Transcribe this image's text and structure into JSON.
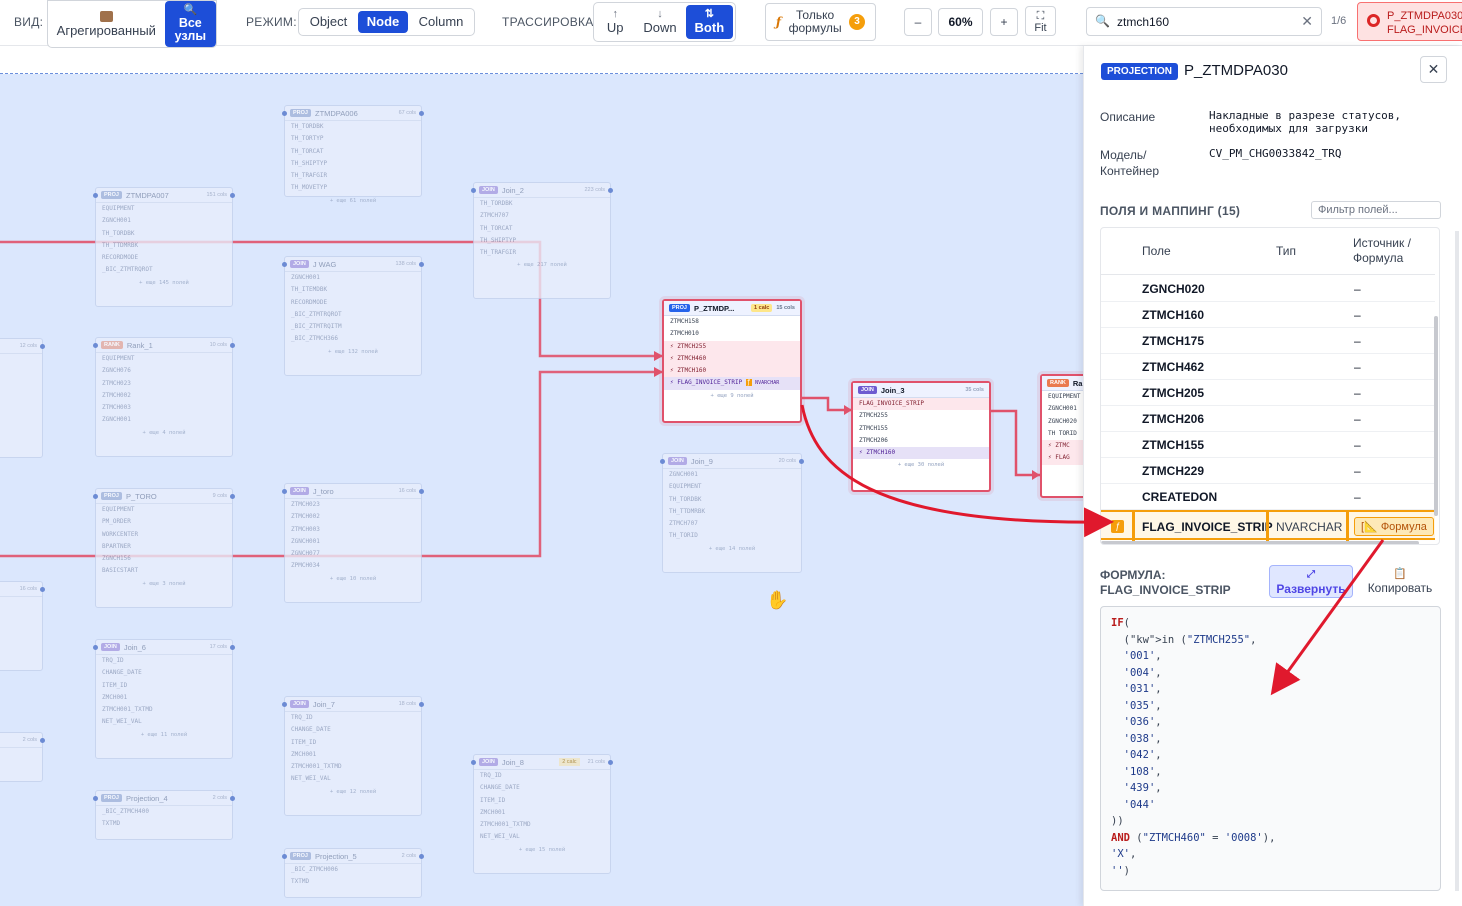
{
  "toolbar": {
    "view_label": "ВИД:",
    "view_options": [
      {
        "label": "Агрегированный",
        "active": false
      },
      {
        "label": "Все узлы",
        "active": true
      }
    ],
    "mode_label": "РЕЖИМ:",
    "mode_options": [
      "Object",
      "Node",
      "Column"
    ],
    "mode_active": "Node",
    "trace_label": "ТРАССИРОВКА:",
    "trace_options": [
      "Up",
      "Down",
      "Both"
    ],
    "trace_active": "Both",
    "formulas_only_label": "Только формулы",
    "formulas_count": "3",
    "zoom_out": "–",
    "zoom_level": "60%",
    "zoom_in": "+",
    "fit_label": "Fit",
    "search_value": "ztmch160",
    "search_count": "1/6",
    "context_chip": "P_ZTMDPA030 FLAG_INVOICE_"
  },
  "panel": {
    "badge": "PROJECTION",
    "title": "P_ZTMDPA030",
    "desc_label": "Описание",
    "desc_value": "Накладные в разрезе статусов, необходимых для загрузки",
    "model_label": "Модель/ Контейнер",
    "model_value": "CV_PM_CHG0033842_TRQ",
    "fields_heading": "ПОЛЯ И МАППИНГ (15)",
    "filter_placeholder": "Фильтр полей...",
    "col_field": "Поле",
    "col_type": "Тип",
    "col_source": "Источник / Формула",
    "rows": [
      {
        "field": "ZGNCH020",
        "type": "",
        "source": "–"
      },
      {
        "field": "ZTMCH160",
        "type": "",
        "source": "–"
      },
      {
        "field": "ZTMCH175",
        "type": "",
        "source": "–"
      },
      {
        "field": "ZTMCH462",
        "type": "",
        "source": "–"
      },
      {
        "field": "ZTMCH205",
        "type": "",
        "source": "–"
      },
      {
        "field": "ZTMCH206",
        "type": "",
        "source": "–"
      },
      {
        "field": "ZTMCH155",
        "type": "",
        "source": "–"
      },
      {
        "field": "ZTMCH229",
        "type": "",
        "source": "–"
      },
      {
        "field": "CREATEDON",
        "type": "",
        "source": "–"
      }
    ],
    "selected_row": {
      "field": "FLAG_INVOICE_STRIP",
      "type": "NVARCHAR",
      "source": "Формула"
    },
    "formula_heading": "ФОРМУЛА:",
    "formula_field": "FLAG_INVOICE_STRIP",
    "expand_label": "Развернуть",
    "copy_label": "Копировать",
    "formula_lines": [
      {
        "kw": "IF",
        "rest": "("
      },
      {
        "kw": "",
        "rest": "  (in (\"ZTMCH255\","
      },
      {
        "kw": "",
        "rest": "  '001',"
      },
      {
        "kw": "",
        "rest": "  '004',"
      },
      {
        "kw": "",
        "rest": "  '031',"
      },
      {
        "kw": "",
        "rest": "  '035',"
      },
      {
        "kw": "",
        "rest": "  '036',"
      },
      {
        "kw": "",
        "rest": "  '038',"
      },
      {
        "kw": "",
        "rest": "  '042',"
      },
      {
        "kw": "",
        "rest": "  '108',"
      },
      {
        "kw": "",
        "rest": "  '439',"
      },
      {
        "kw": "",
        "rest": "  '044'"
      },
      {
        "kw": "",
        "rest": "))"
      },
      {
        "kw": "AND",
        "rest": " (\"ZTMCH460\" = '0008'),"
      },
      {
        "kw": "",
        "rest": "'X',"
      },
      {
        "kw": "",
        "rest": "'')"
      }
    ]
  },
  "graph": {
    "nodes": [
      {
        "id": "n1",
        "tag": "PROJ",
        "name": "ZTMDPA006",
        "cols": "67 cols",
        "rows": [
          "TH_TORDBK",
          "TH_TORTYP",
          "TH_TORCAT",
          "TH_SHIPTYP",
          "TH_TRAFGIR",
          "TH_MOVETYP"
        ],
        "more": "+ еще 61 полей"
      },
      {
        "id": "n2",
        "tag": "PROJ",
        "name": "ZTMDPA007",
        "cols": "151 cols",
        "rows": [
          "EQUIPMENT",
          "ZGNCH001",
          "TH_TORDBK",
          "TH_TTDMRBK",
          "RECORDMODE",
          "_BIC_ZTMTRQROT"
        ],
        "more": "+ еще 145 полей"
      },
      {
        "id": "n3",
        "tag": "JOIN",
        "name": "Join_2",
        "cols": "223 cols",
        "rows": [
          "TH_TORDBK",
          "ZTMCH707",
          "TH_TORCAT",
          "TH_SHIPTYP",
          "TH_TRAFGIR"
        ],
        "more": "+ еще 217 полей"
      },
      {
        "id": "n4",
        "tag": "JOIN",
        "name": "J WAG",
        "cols": "138 cols",
        "rows": [
          "ZGNCH001",
          "TH_ITEMDBK",
          "RECORDMODE",
          "_BIC_ZTMTRQROT",
          "_BIC_ZTMTRQITM",
          "_BIC_ZTMCH366"
        ],
        "more": "+ еще 132 полей"
      },
      {
        "id": "n5",
        "tag": "RANK",
        "name": "Rank_1",
        "cols": "10 cols",
        "rows": [
          "EQUIPMENT",
          "ZGNCH076",
          "ZTMCH023",
          "ZTMCH002",
          "ZTMCH003",
          "ZGNCH001"
        ],
        "more": "+ еще 4 полей"
      },
      {
        "id": "n6",
        "tag": "PROJ",
        "name": "P_TORO",
        "cols": "9 cols",
        "rows": [
          "EQUIPMENT",
          "PM_ORDER",
          "WORKCENTER",
          "BPARTNER",
          "ZGNCH156",
          "BASICSTART"
        ],
        "more": "+ еще 3 полей"
      },
      {
        "id": "n7",
        "tag": "JOIN",
        "name": "J_toro",
        "cols": "16 cols",
        "rows": [
          "ZTMCH023",
          "ZTMCH002",
          "ZTMCH003",
          "ZGNCH001",
          "ZGNCH077",
          "ZPMCH034"
        ],
        "more": "+ еще 10 полей"
      },
      {
        "id": "n8",
        "tag": "JOIN",
        "name": "Join_9",
        "cols": "20 cols",
        "rows": [
          "ZGNCH001",
          "EQUIPMENT",
          "TH_TORDBK",
          "TH_TTDMRBK",
          "ZTMCH707",
          "TH_TORID"
        ],
        "more": "+ еще 14 полей"
      },
      {
        "id": "n9",
        "tag": "JOIN",
        "name": "Join_6",
        "cols": "17 cols",
        "rows": [
          "TRQ_ID",
          "CHANGE_DATE",
          "ITEM_ID",
          "ZMCH001",
          "ZTMCH001_TXTMD",
          "NET_WEI_VAL"
        ],
        "more": "+ еще 11 полей"
      },
      {
        "id": "n10",
        "tag": "JOIN",
        "name": "Join_7",
        "cols": "18 cols",
        "rows": [
          "TRQ_ID",
          "CHANGE_DATE",
          "ITEM_ID",
          "ZMCH001",
          "ZTMCH001_TXTMD",
          "NET_WEI_VAL"
        ],
        "more": "+ еще 12 полей"
      },
      {
        "id": "n11",
        "tag": "JOIN",
        "name": "Join_8",
        "cols": "21 cols",
        "extra": "2 calc",
        "rows": [
          "TRQ_ID",
          "CHANGE_DATE",
          "ITEM_ID",
          "ZMCH001",
          "ZTMCH001_TXTMD",
          "NET_WEI_VAL"
        ],
        "more": "+ еще 15 полей"
      },
      {
        "id": "n12",
        "tag": "PROJ",
        "name": "Projection_4",
        "cols": "2 cols",
        "rows": [
          "_BIC_ZTMCH400",
          "TXTMD"
        ],
        "more": ""
      },
      {
        "id": "n13",
        "tag": "PROJ",
        "name": "Projection_5",
        "cols": "2 cols",
        "rows": [
          "_BIC_ZTMCH006",
          "TXTMD"
        ],
        "more": ""
      },
      {
        "id": "n14",
        "tag": "",
        "name": "",
        "cols": "12 cols",
        "rows": [],
        "more": ""
      },
      {
        "id": "n15",
        "tag": "",
        "name": "",
        "cols": "16 cols",
        "rows": [],
        "more": ""
      },
      {
        "id": "n16",
        "tag": "",
        "name": "",
        "cols": "2 cols",
        "rows": [],
        "more": ""
      }
    ],
    "active_node": {
      "tag": "PROJ",
      "name": "P_ZTMDP...",
      "calc": "1 calc",
      "cols": "15 cols",
      "rows": [
        "ZTMCH158",
        "ZTMCH010",
        "ZTMCH255",
        "ZTMCH460",
        "ZTMCH160",
        "FLAG_INVOICE_STRIP"
      ],
      "type": "NVARCHAR",
      "more": "+ еще 9 полей"
    },
    "join3": {
      "tag": "JOIN",
      "name": "Join_3",
      "cols": "35 cols",
      "rows": [
        "FLAG_INVOICE_STRIP",
        "ZTMCH255",
        "ZTMCH155",
        "ZTMCH206",
        "ZTMCH160"
      ],
      "more": "+ еще 30 полей"
    },
    "rank_node": {
      "tag": "RANK",
      "name": "Ra",
      "rows": [
        "EQUIPMENT",
        "ZGNCH001",
        "ZGNCH020",
        "TH TORID",
        "ZTMC",
        "FLAG"
      ]
    }
  },
  "colors": {
    "accent": "#1d4ed8",
    "trace": "#e0526b",
    "annotation": "#e0192d",
    "canvas": "#dbe7fd"
  }
}
